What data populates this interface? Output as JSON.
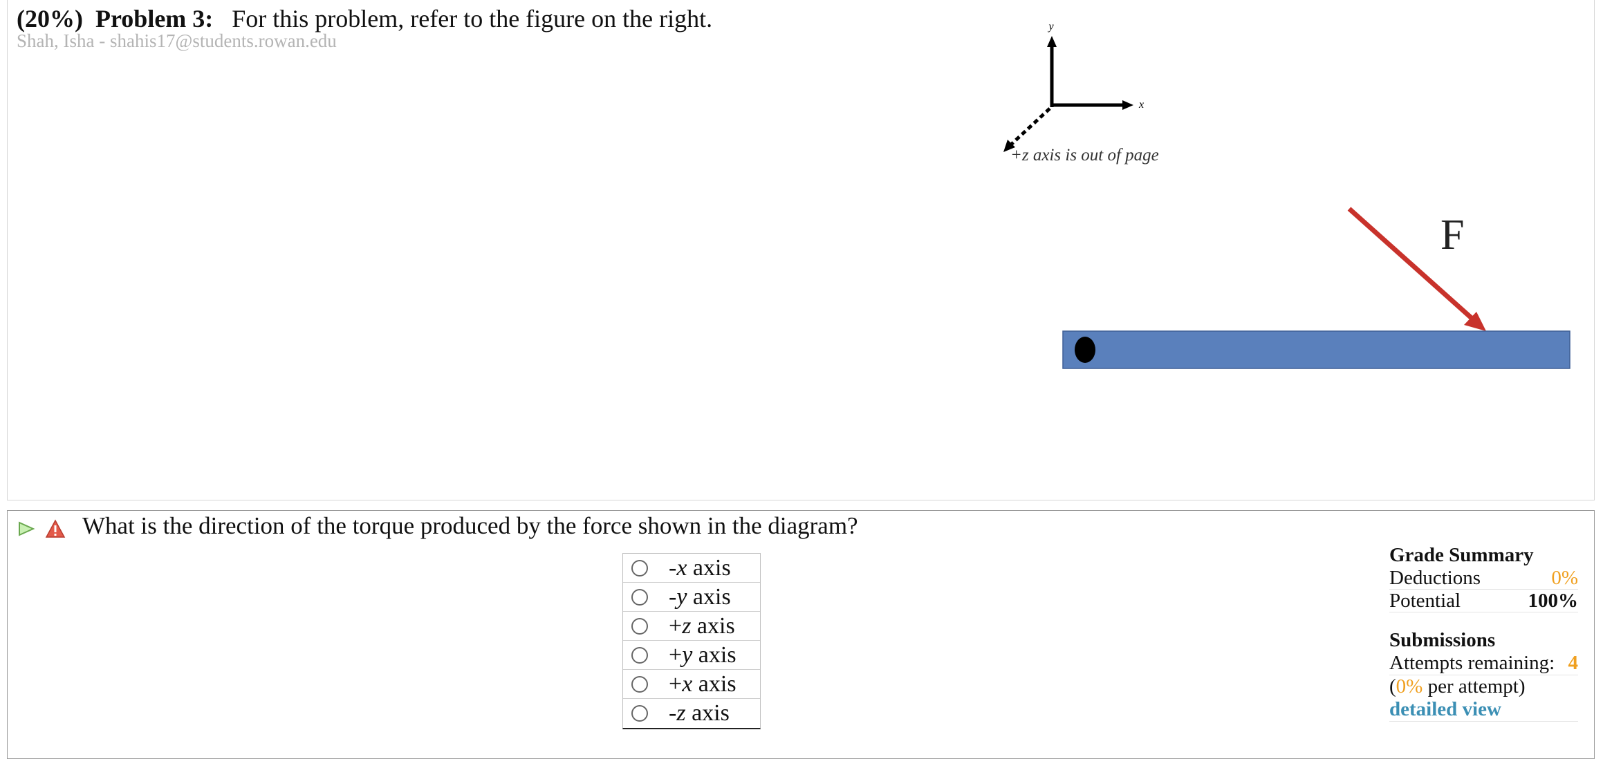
{
  "problem": {
    "weight": "(20%)",
    "label": "Problem 3:",
    "instruction": "For this problem, refer to the figure on the right.",
    "student": "Shah, Isha - shahis17@students.rowan.edu"
  },
  "figure": {
    "x_label": "x",
    "y_label": "y",
    "z_note": "+z axis is out of page",
    "force_label": "F",
    "colors": {
      "bar": "#5a80bc",
      "force": "#c8322b",
      "pivot": "#000000"
    }
  },
  "question": {
    "text": "What is the direction of the torque produced by the force shown in the diagram?",
    "choices": [
      {
        "sign": "-",
        "var": "x",
        "rest": " axis"
      },
      {
        "sign": "-",
        "var": "y",
        "rest": " axis"
      },
      {
        "sign": "+",
        "var": "z",
        "rest": " axis"
      },
      {
        "sign": "+",
        "var": "y",
        "rest": " axis"
      },
      {
        "sign": "+",
        "var": "x",
        "rest": " axis"
      },
      {
        "sign": "-",
        "var": "z",
        "rest": " axis"
      }
    ]
  },
  "grade_summary": {
    "heading": "Grade Summary",
    "deductions_label": "Deductions",
    "deductions_value": "0%",
    "potential_label": "Potential",
    "potential_value": "100%"
  },
  "submissions": {
    "heading": "Submissions",
    "attempts_label": "Attempts remaining:",
    "attempts_value": "4",
    "per_attempt_open": "(",
    "per_attempt_value": "0%",
    "per_attempt_rest": " per attempt)",
    "detail_link": "detailed view"
  },
  "icons": [
    "play-triangle-icon",
    "warning-icon"
  ]
}
